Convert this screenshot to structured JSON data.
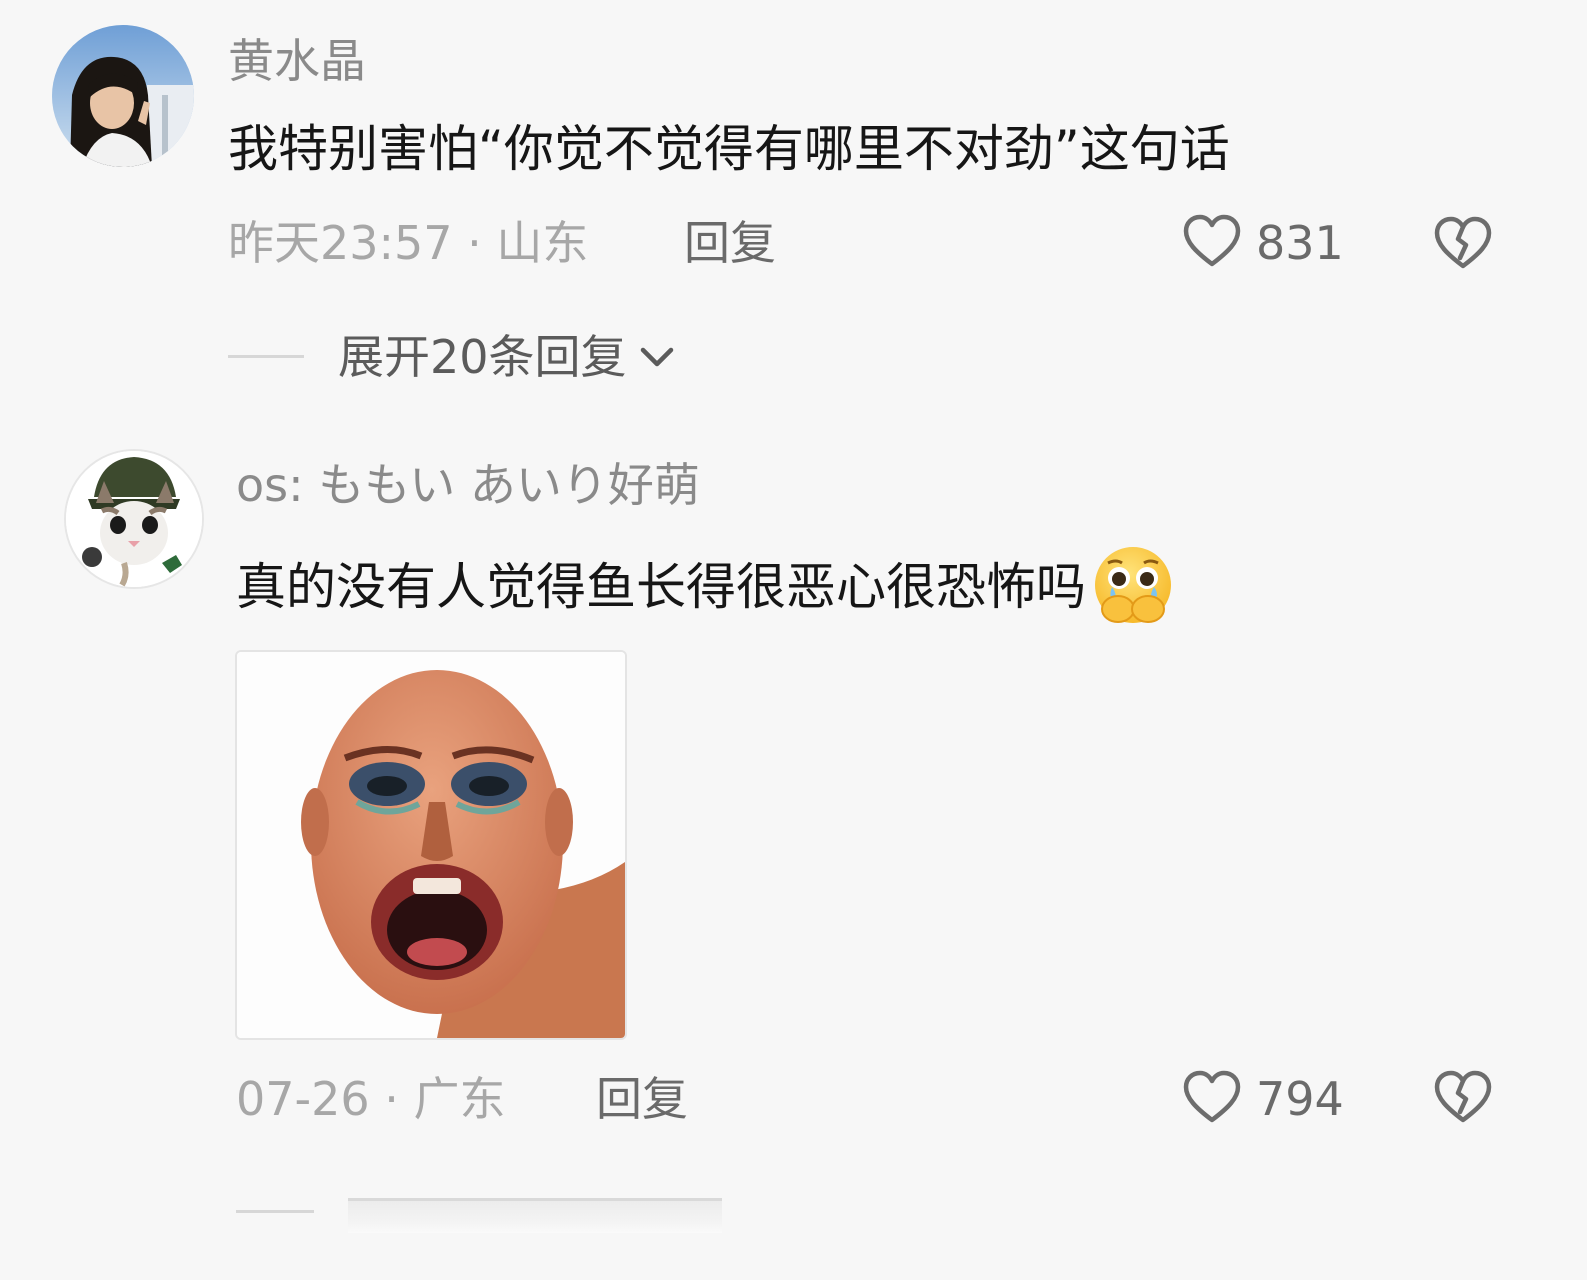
{
  "comments": [
    {
      "username": "黄水晶",
      "text": "我特别害怕“你觉不觉得有哪里不对劲”这句话",
      "meta": "昨天23:57 · 山东",
      "reply_label": "回复",
      "likes": "831",
      "expand_label": "展开20条回复"
    },
    {
      "username": "os: ももい あいり好萌",
      "text": "真的没有人觉得鱼长得很恶心很恐怖吗",
      "emoji": "crying-face-covering-mouth",
      "meta": "07-26 · 广东",
      "reply_label": "回复",
      "likes": "794"
    }
  ],
  "icons": {
    "like": "heart-outline-icon",
    "dislike": "broken-heart-icon",
    "expand": "chevron-down-icon"
  },
  "colors": {
    "background": "#f7f7f7",
    "primary_text": "#161616",
    "secondary_text": "#a7a7a7",
    "action_text": "#6a6a6a"
  }
}
